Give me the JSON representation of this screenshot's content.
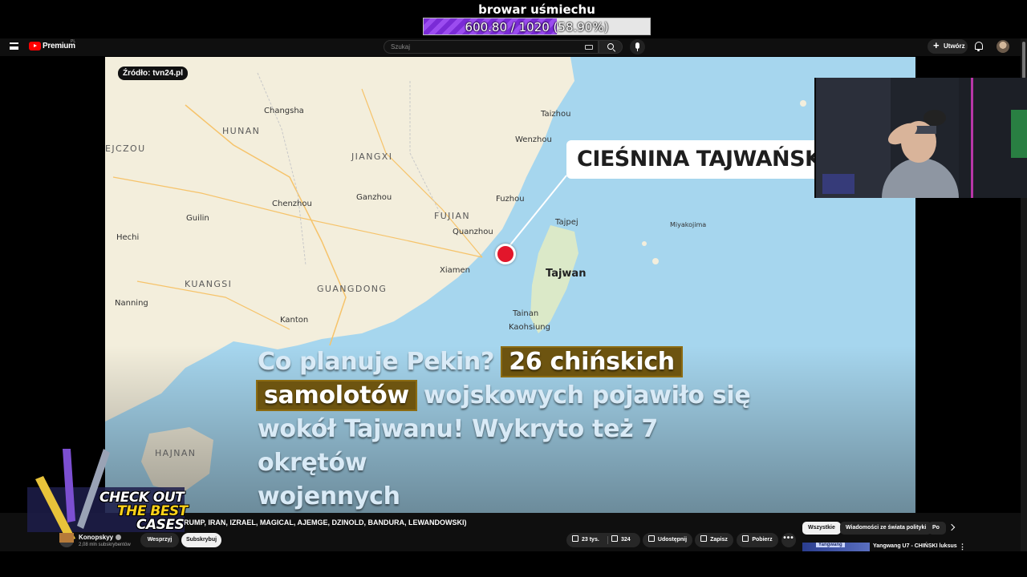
{
  "stream_goal": {
    "title": "browar uśmiechu",
    "progress_text": "600.80 / 1020 (58.90%)",
    "progress_fraction": 0.589,
    "fill_color": "#8a3be6"
  },
  "youtube": {
    "logo_text": "Premium",
    "region": "PL",
    "search_placeholder": "Szukaj",
    "create_label": "Utwórz",
    "icons": [
      "menu-icon",
      "youtube-logo-icon",
      "keyboard-icon",
      "search-icon",
      "mic-icon",
      "bell-icon",
      "avatar"
    ]
  },
  "video": {
    "source_badge": "Źródło: tvn24.pl",
    "strait_label": "CIEŚNINA TAJWAŃSKA",
    "map_labels": {
      "changsha": "Changsha",
      "hunan": "HUNAN",
      "ejczou": "EJCZOU",
      "jiangxi": "JIANGXI",
      "taizhou": "Taizhou",
      "wenzhou": "Wenzhou",
      "fuzhou": "Fuzhou",
      "fujian": "FUJIAN",
      "quanzhou": "Quanzhou",
      "xiamen": "Xiamen",
      "tajpej": "Tajpej",
      "taiwan": "Tajwan",
      "tainan": "Tainan",
      "kaohsiung": "Kaohsiung",
      "kuangsi": "KUANGSI",
      "guangdong": "GUANGDONG",
      "nanning": "Nanning",
      "kanton": "Kanton",
      "hajnan": "HAJNAN",
      "chenzhou": "Chenzhou",
      "ganzhou": "Ganzhou",
      "guilin": "Guilin",
      "hechi": "Hechi",
      "miyakojima": "Miyakojima"
    },
    "caption_highlight": "26 chińskich samolotów",
    "caption_line1_prefix": "Co planuje Pekin?",
    "caption_line1_hl": "26 chińskich",
    "caption_line2_hl": "samolotów",
    "caption_line2_rest": "wojskowych pojawiło się",
    "caption_line3": "wokół Tajwanu! Wykryto też 7 okrętów",
    "caption_line4": "wojennych",
    "colors": {
      "water": "#a6d6ee",
      "land": "#f3eedc",
      "marker": "#e2162b",
      "highlight": "#6d5410"
    }
  },
  "promo": {
    "line1": "CHECK OUT",
    "line2": "THE BEST",
    "line3": "CASES"
  },
  "below_video": {
    "title_fragment": "RUMP, IRAN, IZRAEL, MAGICAL, AJEMGE, DZINOLD, BANDURA, LEWANDOWSKI)",
    "channel_name": "Konopskyy",
    "channel_subs": "2,08 mln subskrybentów",
    "support_label": "Wesprzyj",
    "subscribe_label": "Subskrybuj",
    "likes": "23 tys.",
    "dislikes": "324",
    "share_label": "Udostępnij",
    "save_label": "Zapisz",
    "download_label": "Pobierz",
    "more_label": "•••"
  },
  "sidebar_chips": [
    "Wszystkie",
    "Wiadomości ze świata polityki",
    "Po"
  ],
  "recommendation": {
    "thumb_text": "Yangwang",
    "title": "Yangwang U7 - CHIŃSKI luksus"
  }
}
